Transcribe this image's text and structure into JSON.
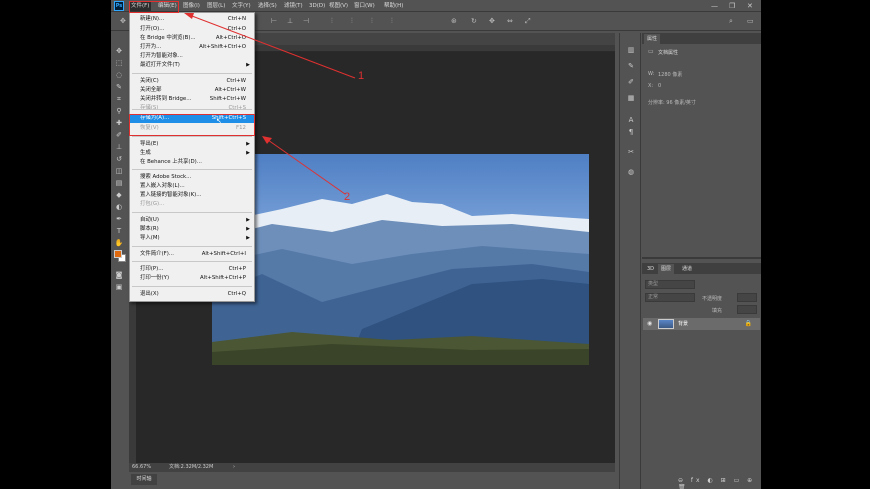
{
  "menubar": {
    "logo": "Ps",
    "items": [
      "文件(F)",
      "编辑(E)",
      "图像(I)",
      "图层(L)",
      "文字(Y)",
      "选择(S)",
      "滤镜(T)",
      "3D(D)",
      "视图(V)",
      "窗口(W)",
      "帮助(H)"
    ],
    "minimize": "—",
    "restore": "❐",
    "close": "✕"
  },
  "file_menu": {
    "items": [
      {
        "label": "新建(N)...",
        "shortcut": "Ctrl+N"
      },
      {
        "label": "打开(O)...",
        "shortcut": "Ctrl+O"
      },
      {
        "label": "在 Bridge 中浏览(B)...",
        "shortcut": "Alt+Ctrl+O"
      },
      {
        "label": "打开为...",
        "shortcut": "Alt+Shift+Ctrl+O"
      },
      {
        "label": "打开为智能对象...",
        "shortcut": ""
      },
      {
        "label": "最近打开文件(T)",
        "shortcut": "",
        "submenu": true
      },
      {
        "label": "关闭(C)",
        "shortcut": "Ctrl+W"
      },
      {
        "label": "关闭全部",
        "shortcut": "Alt+Ctrl+W"
      },
      {
        "label": "关闭并转到 Bridge...",
        "shortcut": "Shift+Ctrl+W"
      },
      {
        "label": "存储(S)",
        "shortcut": "Ctrl+S",
        "disabled": true
      },
      {
        "label": "存储为(A)...",
        "shortcut": "Shift+Ctrl+S",
        "highlighted": true
      },
      {
        "label": "恢复(V)",
        "shortcut": "F12",
        "disabled": true
      },
      {
        "label": "导出(E)",
        "shortcut": "",
        "submenu": true
      },
      {
        "label": "生成",
        "shortcut": "",
        "submenu": true
      },
      {
        "label": "在 Behance 上共享(D)...",
        "shortcut": ""
      },
      {
        "label": "搜索 Adobe Stock...",
        "shortcut": ""
      },
      {
        "label": "置入嵌入对象(L)...",
        "shortcut": ""
      },
      {
        "label": "置入链接的智能对象(K)...",
        "shortcut": ""
      },
      {
        "label": "打包(G)...",
        "shortcut": "",
        "disabled": true
      },
      {
        "label": "自动(U)",
        "shortcut": "",
        "submenu": true
      },
      {
        "label": "脚本(R)",
        "shortcut": "",
        "submenu": true
      },
      {
        "label": "导入(M)",
        "shortcut": "",
        "submenu": true
      },
      {
        "label": "文件简介(F)...",
        "shortcut": "Alt+Shift+Ctrl+I"
      },
      {
        "label": "打印(P)...",
        "shortcut": "Ctrl+P"
      },
      {
        "label": "打印一份(Y)",
        "shortcut": "Alt+Shift+Ctrl+P"
      },
      {
        "label": "退出(X)",
        "shortcut": "Ctrl+Q"
      }
    ]
  },
  "properties_panel": {
    "tab": "属性",
    "section": "文档属性",
    "width_label": "W:",
    "width_value": "1280 像素",
    "x_label": "X:",
    "x_value": "0",
    "resolution": "分辨率: 96 像素/英寸"
  },
  "layers_panel": {
    "tabs": [
      "3D",
      "图层",
      "通道"
    ],
    "mode": "正常",
    "opacity": "不透明度",
    "fill": "填充",
    "search_placeholder": "类型",
    "layer_name": "背景",
    "footer_icons": "⊖ fx ◐ ⊞ ▭ ⊕ 🗑"
  },
  "status": {
    "zoom": "66.67%",
    "doc": "文档:2.32M/2.32M"
  },
  "bottom_tab": "时间轴",
  "annotations": [
    "1",
    "2"
  ],
  "colors": {
    "ui_gray": "#535353",
    "highlight": "#1e8ee6",
    "annotation": "#e03030",
    "foreground_swatch": "#e0680d"
  }
}
